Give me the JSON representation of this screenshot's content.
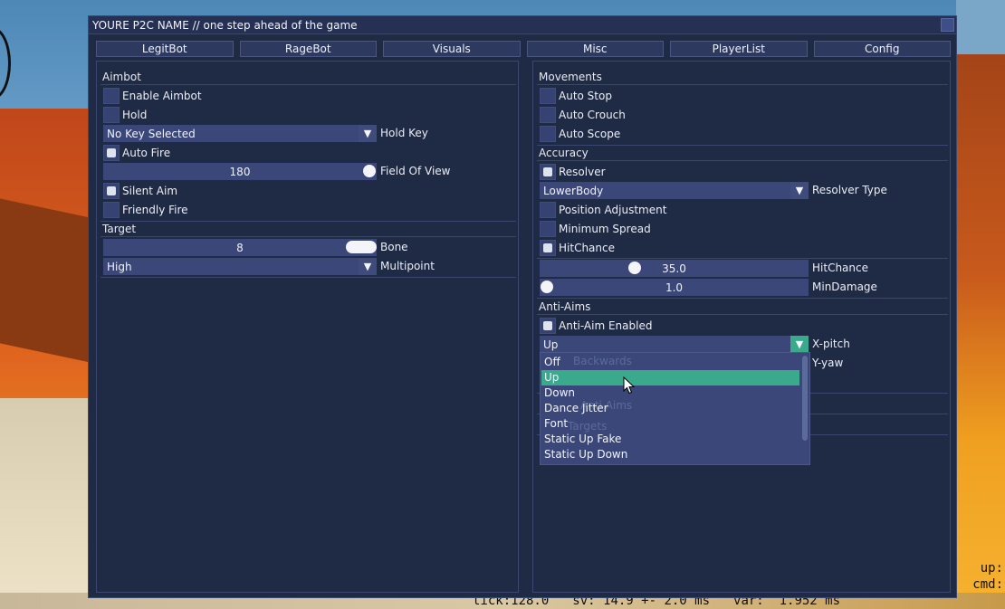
{
  "window": {
    "title": "YOURE P2C NAME  // one step ahead of the game"
  },
  "tabs": [
    "LegitBot",
    "RageBot",
    "Visuals",
    "Misc",
    "PlayerList",
    "Config"
  ],
  "left": {
    "aimbot_header": "Aimbot",
    "enable_aimbot": "Enable Aimbot",
    "hold": "Hold",
    "hold_key_value": "No Key Selected",
    "hold_key_label": "Hold Key",
    "auto_fire": "Auto Fire",
    "fov_value": "180",
    "fov_label": "Field Of View",
    "silent_aim": "Silent Aim",
    "friendly_fire": "Friendly Fire",
    "target_header": "Target",
    "bone_value": "8",
    "bone_label": "Bone",
    "multipoint_value": "High",
    "multipoint_label": "Multipoint"
  },
  "right": {
    "movements_header": "Movements",
    "auto_stop": "Auto Stop",
    "auto_crouch": "Auto Crouch",
    "auto_scope": "Auto Scope",
    "accuracy_header": "Accuracy",
    "resolver": "Resolver",
    "resolver_type_value": "LowerBody",
    "resolver_type_label": "Resolver Type",
    "position_adjustment": "Position Adjustment",
    "minimum_spread": "Minimum Spread",
    "hitchance": "HitChance",
    "hitchance_value": "35.0",
    "hitchance_label": "HitChance",
    "mindamage_value": "1.0",
    "mindamage_label": "MinDamage",
    "antiaim_header": "Anti-Aims",
    "antiaim_enabled": "Anti-Aim Enabled",
    "xpitch_value": "Up",
    "xpitch_label": "X-pitch",
    "yyaw_label": "Y-yaw"
  },
  "dropdown": {
    "options": [
      "Off",
      "Up",
      "Down",
      "Dance Jitter",
      "Font",
      "Static Up Fake",
      "Static Up Down"
    ],
    "selected": "Up",
    "ghost_1": "Backwards",
    "ghost_2": "Anti Aims",
    "ghost_3": "Targets"
  },
  "overlay": {
    "tick": "tick:128.0",
    "sv": "sv: 14.9 +- 2.0 ms",
    "var": "var:  1.952 ms",
    "up": "up:",
    "cmd": "cmd:"
  },
  "colors": {
    "window_bg": "#1f2a45",
    "control_bg": "#3b4778",
    "accent_selected": "#3aa98c"
  }
}
